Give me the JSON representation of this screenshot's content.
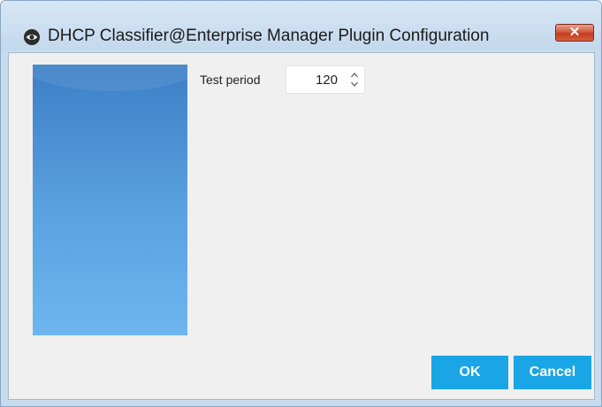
{
  "window": {
    "title": "DHCP Classifier@Enterprise Manager Plugin Configuration",
    "close_glyph": "✕",
    "app_icon": "eye-logo-icon"
  },
  "form": {
    "test_period": {
      "label": "Test period",
      "value": "120"
    }
  },
  "buttons": {
    "ok": "OK",
    "cancel": "Cancel"
  },
  "colors": {
    "accent_button": "#1aa5e6",
    "banner_top": "#3d7fc6",
    "banner_bottom": "#6db6f0",
    "close_button": "#c33a1c"
  }
}
